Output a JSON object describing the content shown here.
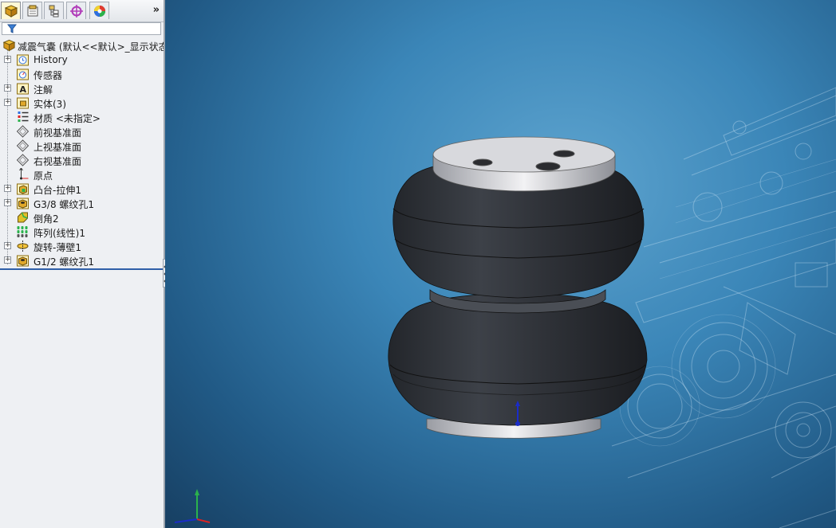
{
  "colors": {
    "panel_bg": "#eef0f3",
    "viewport_blue": "#3b86b8",
    "rollback_bar": "#2f5fa8",
    "bellows_black": "#2b2e34"
  },
  "tabs": [
    {
      "name": "feature-manager-tab",
      "icon": "feature-tree-icon",
      "active": true
    },
    {
      "name": "property-manager-tab",
      "icon": "property-icon"
    },
    {
      "name": "configuration-manager-tab",
      "icon": "configuration-icon"
    },
    {
      "name": "dimxpert-tab",
      "icon": "crosshair-icon"
    },
    {
      "name": "display-manager-tab",
      "icon": "appearance-icon"
    }
  ],
  "tab_more": "»",
  "tree": {
    "root": "减震气囊  (默认<<默认>_显示状态",
    "items": [
      {
        "label": "History",
        "icon": "history-icon",
        "expandable": true
      },
      {
        "label": "传感器",
        "icon": "sensor-icon",
        "expandable": false
      },
      {
        "label": "注解",
        "icon": "annotation-icon",
        "expandable": true
      },
      {
        "label": "实体(3)",
        "icon": "solid-bodies-icon",
        "expandable": true
      },
      {
        "label": "材质 <未指定>",
        "icon": "material-icon",
        "expandable": false
      },
      {
        "label": "前视基准面",
        "icon": "plane-icon",
        "expandable": false
      },
      {
        "label": "上视基准面",
        "icon": "plane-icon",
        "expandable": false
      },
      {
        "label": "右视基准面",
        "icon": "plane-icon",
        "expandable": false
      },
      {
        "label": "原点",
        "icon": "origin-icon",
        "expandable": false
      },
      {
        "label": "凸台-拉伸1",
        "icon": "extrude-icon",
        "expandable": true
      },
      {
        "label": "G3/8 螺纹孔1",
        "icon": "hole-icon",
        "expandable": true
      },
      {
        "label": "倒角2",
        "icon": "chamfer-icon",
        "expandable": false
      },
      {
        "label": "阵列(线性)1",
        "icon": "linear-pattern-icon",
        "expandable": false
      },
      {
        "label": "旋转-薄壁1",
        "icon": "revolve-icon",
        "expandable": true
      },
      {
        "label": "G1/2 螺纹孔1",
        "icon": "hole-icon",
        "expandable": true
      }
    ]
  }
}
